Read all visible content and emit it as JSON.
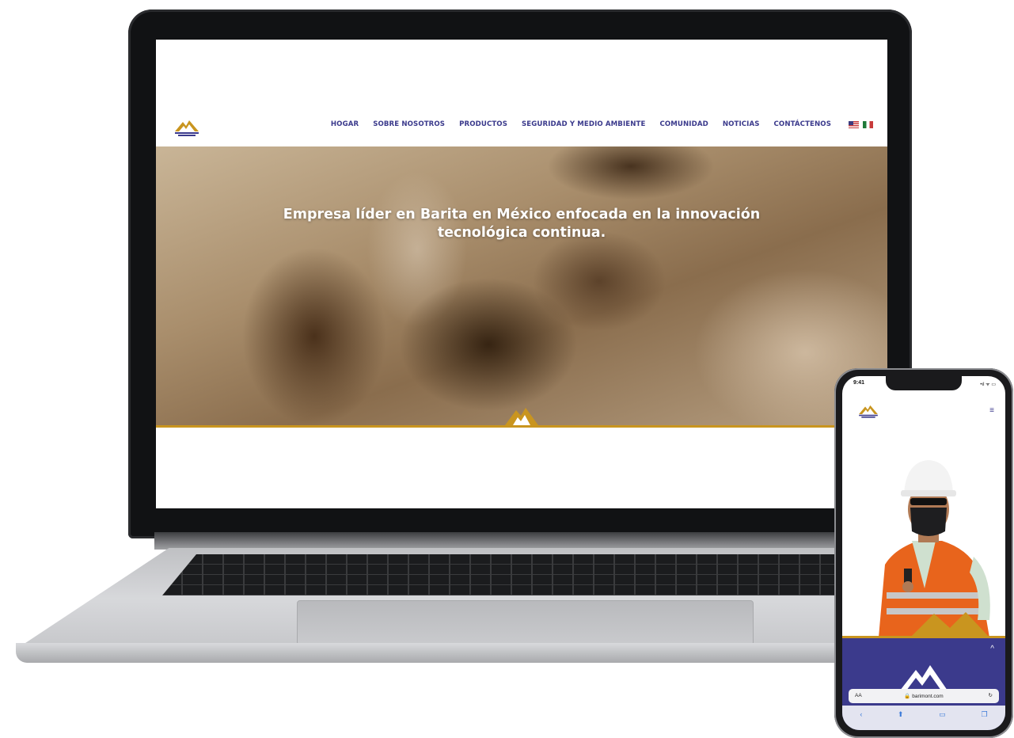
{
  "laptop_site": {
    "nav": [
      "HOGAR",
      "SOBRE NOSOTROS",
      "PRODUCTOS",
      "SEGURIDAD Y MEDIO AMBIENTE",
      "COMUNIDAD",
      "NOTICIAS",
      "CONTÁCTENOS"
    ],
    "hero_title": "Empresa líder en Barita en México enfocada en la innovación tecnológica continua.",
    "flags": [
      "us-flag",
      "mx-flag"
    ]
  },
  "phone": {
    "time": "9:41",
    "status_icons": "•ıl ᯤ ▭",
    "menu_icon": "≡",
    "up_icon": "^",
    "address": {
      "aa": "AA",
      "url": "🔒 barimont.com",
      "reload": "↻"
    },
    "toolbar": [
      "‹",
      "⬆",
      "▭",
      "❐"
    ]
  },
  "colors": {
    "brand_blue": "#3b3a8c",
    "accent_gold": "#c9951f"
  }
}
